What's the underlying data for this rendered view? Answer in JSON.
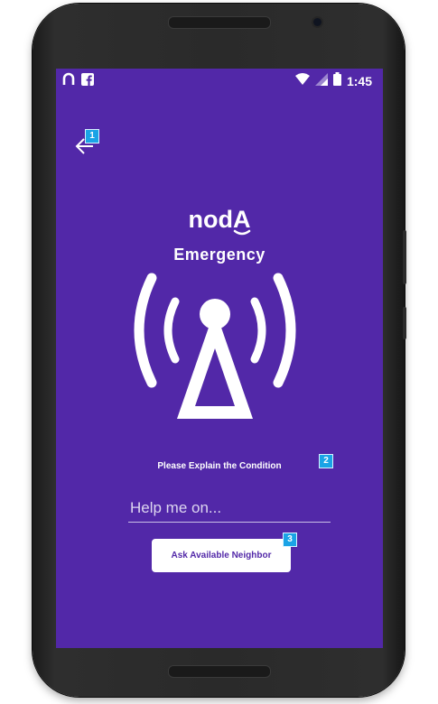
{
  "statusbar": {
    "time": "1:45",
    "left_icons": [
      "noda-app-icon",
      "facebook-icon"
    ],
    "right_icons": [
      "wifi-icon",
      "signal-icon",
      "battery-icon"
    ]
  },
  "header": {
    "back_icon": "arrow-left-icon"
  },
  "brand": {
    "logo_text": "nodA"
  },
  "page": {
    "title": "Emergency",
    "tower_icon": "broadcast-tower-icon"
  },
  "form": {
    "instruction": "Please Explain the Condition",
    "input_value": "",
    "input_placeholder": "Help me on...",
    "button_label": "Ask Available Neighbor"
  },
  "markers": [
    "1",
    "2",
    "3"
  ],
  "colors": {
    "background": "#5228a8",
    "accent_marker": "#1aa3e6",
    "text": "#ffffff"
  }
}
